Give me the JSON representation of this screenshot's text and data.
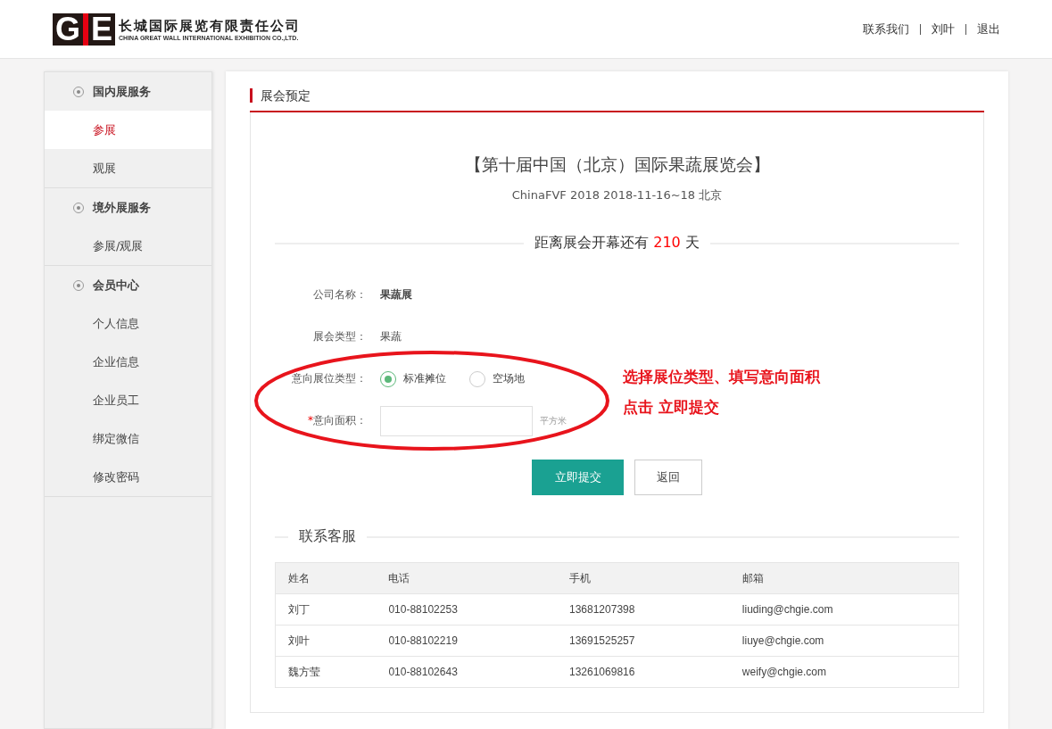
{
  "header": {
    "logo": {
      "letters": [
        "G",
        "E"
      ],
      "name_cn": "长城国际展览有限责任公司",
      "name_en": "CHINA GREAT WALL INTERNATIONAL EXHIBITION CO.,LTD."
    },
    "links": [
      "联系我们",
      "刘叶",
      "退出"
    ]
  },
  "sidebar": [
    {
      "title": "国内展服务",
      "items": [
        {
          "label": "参展",
          "selected": true
        },
        {
          "label": "观展",
          "selected": false
        }
      ]
    },
    {
      "title": "境外展服务",
      "items": [
        {
          "label": "参展/观展",
          "selected": false
        }
      ]
    },
    {
      "title": "会员中心",
      "items": [
        {
          "label": "个人信息",
          "selected": false
        },
        {
          "label": "企业信息",
          "selected": false
        },
        {
          "label": "企业员工",
          "selected": false
        },
        {
          "label": "绑定微信",
          "selected": false
        },
        {
          "label": "修改密码",
          "selected": false
        }
      ]
    }
  ],
  "panel": {
    "title": "展会预定",
    "exhibition": {
      "name": "【第十届中国（北京）国际果蔬展览会】",
      "subtitle": "ChinaFVF 2018 2018-11-16~18 北京"
    },
    "countdown": {
      "prefix": "距离展会开幕还有",
      "days": "210",
      "suffix": "天"
    },
    "form": [
      {
        "kind": "text",
        "label": "公司名称：",
        "value": "果蔬展",
        "bold": true
      },
      {
        "kind": "text",
        "label": "展会类型：",
        "value": "果蔬",
        "bold": false
      },
      {
        "kind": "radio",
        "label": "意向展位类型：",
        "options": [
          {
            "label": "标准摊位",
            "selected": true
          },
          {
            "label": "空场地",
            "selected": false
          }
        ]
      },
      {
        "kind": "input",
        "label": "意向面积：",
        "required_mark": "*",
        "unit": "平方米"
      }
    ],
    "annotation": [
      "选择展位类型、填写意向面积",
      "点击 立即提交"
    ],
    "buttons": [
      {
        "label": "立即提交",
        "primary": true
      },
      {
        "label": "返回",
        "primary": false
      }
    ],
    "contacts": {
      "title": "联系客服",
      "columns": [
        "姓名",
        "电话",
        "手机",
        "邮箱"
      ],
      "rows": [
        [
          "刘丁",
          "010-88102253",
          "13681207398",
          "liuding@chgie.com"
        ],
        [
          "刘叶",
          "010-88102219",
          "13691525257",
          "liuye@chgie.com"
        ],
        [
          "魏方莹",
          "010-88102643",
          "13261069816",
          "weify@chgie.com"
        ]
      ]
    }
  }
}
